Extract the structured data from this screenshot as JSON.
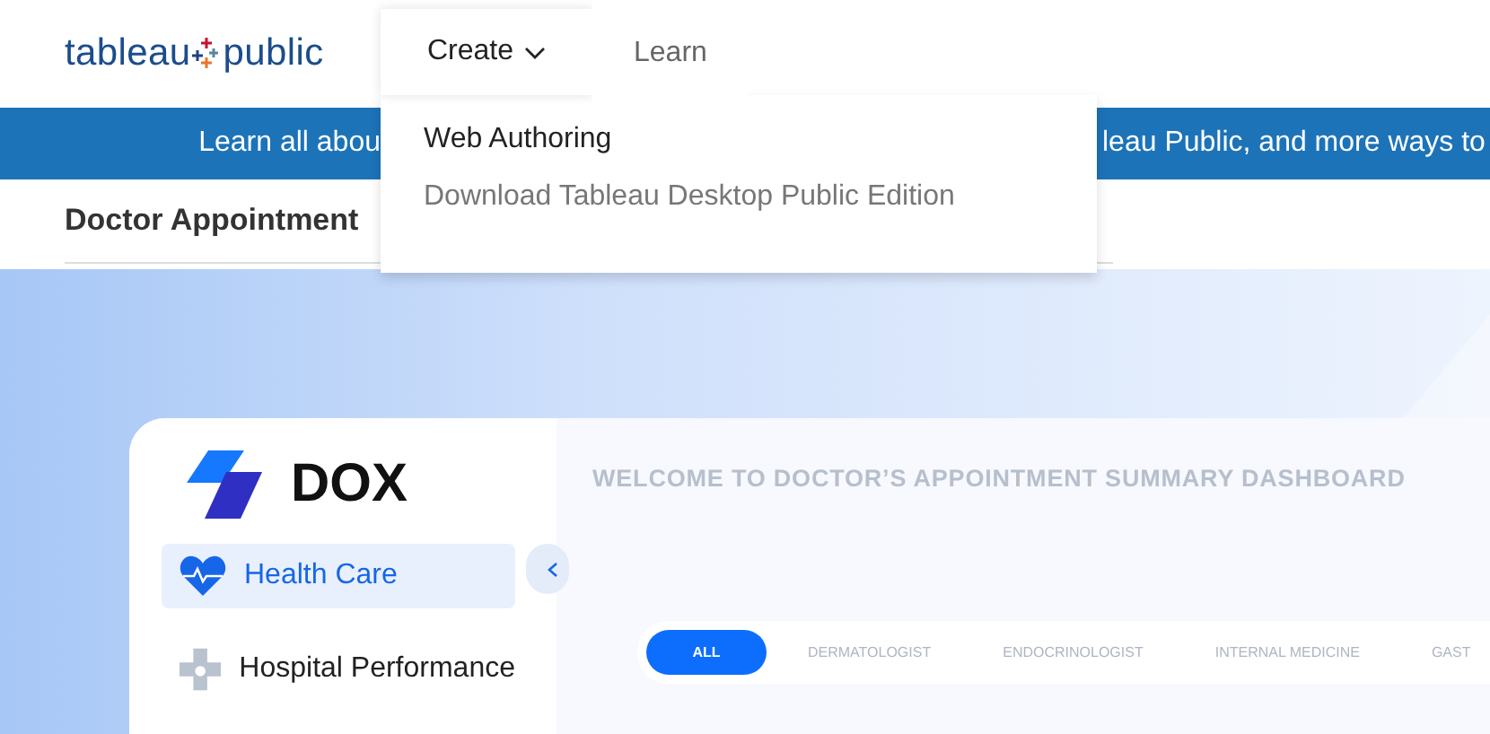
{
  "header": {
    "logo": {
      "left": "tableau",
      "right": "public"
    },
    "nav": [
      {
        "label": "Create",
        "selected": true,
        "kind": "menu"
      },
      {
        "label": "Learn",
        "selected": false,
        "kind": "link"
      }
    ]
  },
  "dropdown": {
    "items": [
      {
        "label": "Web Authoring",
        "disabled": false
      },
      {
        "label": "Download Tableau Desktop Public Edition",
        "disabled": true
      }
    ]
  },
  "banner": {
    "left": "Learn all abou",
    "right": "leau Public, and more ways to"
  },
  "page_title": "Doctor Appointment",
  "dashboard": {
    "brand": "DOX",
    "sidebar": [
      {
        "label": "Health Care",
        "selected": true,
        "kind": "heart"
      },
      {
        "label": "Hospital Performance",
        "selected": false,
        "kind": "cross"
      }
    ],
    "title": "WELCOME TO DOCTOR’S APPOINTMENT SUMMARY DASHBOARD",
    "filters": [
      {
        "label": "ALL",
        "selected": true
      },
      {
        "label": "DERMATOLOGIST",
        "selected": false
      },
      {
        "label": "ENDOCRINOLOGIST",
        "selected": false
      },
      {
        "label": "INTERNAL MEDICINE",
        "selected": false
      },
      {
        "label": "GAST",
        "selected": false
      }
    ]
  }
}
